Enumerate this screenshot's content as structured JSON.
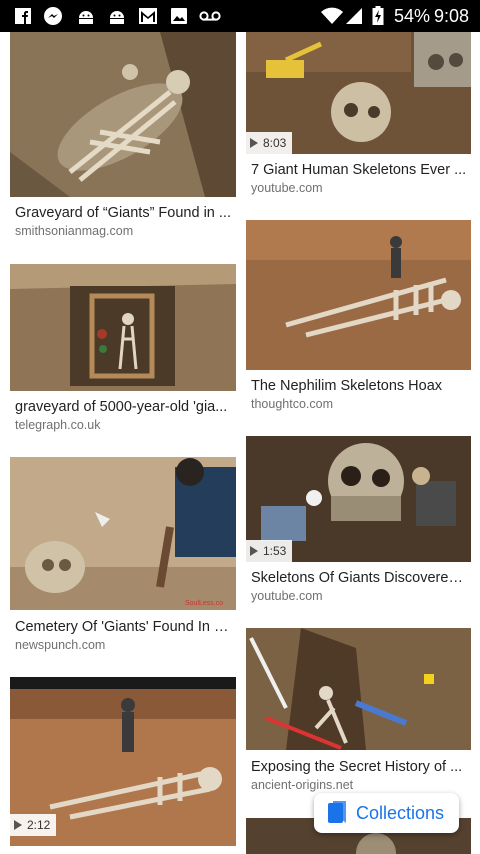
{
  "status_bar": {
    "battery": "54%",
    "time": "9:08",
    "icons": [
      "facebook-icon",
      "messenger-icon",
      "android-icon",
      "android-icon",
      "gmail-icon",
      "image-icon",
      "voicemail-icon"
    ]
  },
  "results": [
    {
      "title": "Graveyard of “Giants” Found in ...",
      "source": "smithsonianmag.com",
      "duration": ""
    },
    {
      "title": "7 Giant Human Skeletons Ever ...",
      "source": "youtube.com",
      "duration": "8:03"
    },
    {
      "title": "graveyard of 5000-year-old 'gia...",
      "source": "telegraph.co.uk",
      "duration": ""
    },
    {
      "title": "The Nephilim Skeletons Hoax",
      "source": "thoughtco.com",
      "duration": ""
    },
    {
      "title": "Cemetery Of 'Giants' Found In C...",
      "source": "newspunch.com",
      "duration": ""
    },
    {
      "title": "Skeletons Of Giants Discovered...",
      "source": "youtube.com",
      "duration": "1:53"
    },
    {
      "title": "",
      "source": "",
      "duration": "2:12"
    },
    {
      "title": "Exposing the Secret History of ...",
      "source": "ancient-origins.net",
      "duration": ""
    }
  ],
  "collections_button": {
    "label": "Collections"
  },
  "colors": {
    "accent": "#1a73e8",
    "status_bar": "#000000"
  }
}
